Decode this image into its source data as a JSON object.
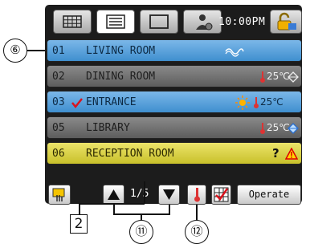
{
  "header": {
    "clock": "10:00PM",
    "tabs": [
      {
        "name": "grid-view-tab",
        "icon": "grid-icon"
      },
      {
        "name": "list-view-tab",
        "icon": "list-icon"
      },
      {
        "name": "single-view-tab",
        "icon": "square-icon"
      },
      {
        "name": "user-settings-tab",
        "icon": "person-gear-icon"
      }
    ],
    "lock_icon": "padlock-icon"
  },
  "rooms": [
    {
      "num": "01",
      "name": "LIVING ROOM",
      "temp": "",
      "color": "blue"
    },
    {
      "num": "02",
      "name": "DINING ROOM",
      "temp": "25℃",
      "color": "gray"
    },
    {
      "num": "03",
      "name": "ENTRANCE",
      "temp": "25℃",
      "color": "blue"
    },
    {
      "num": "05",
      "name": "LIBRARY",
      "temp": "25℃",
      "color": "gray"
    },
    {
      "num": "06",
      "name": "RECEPTION ROOM",
      "temp": "",
      "color": "yellow",
      "status": "?"
    }
  ],
  "footer": {
    "page": "1/5",
    "operate_label": "Operate"
  },
  "callouts": {
    "c6": "⑥",
    "c2": "2",
    "c11": "⑪",
    "c12": "⑫"
  },
  "colors": {
    "row_blue": "#4f9ad6",
    "row_gray": "#6f6f6f",
    "row_yellow": "#d9d040",
    "panel": "#1c1c1c"
  }
}
